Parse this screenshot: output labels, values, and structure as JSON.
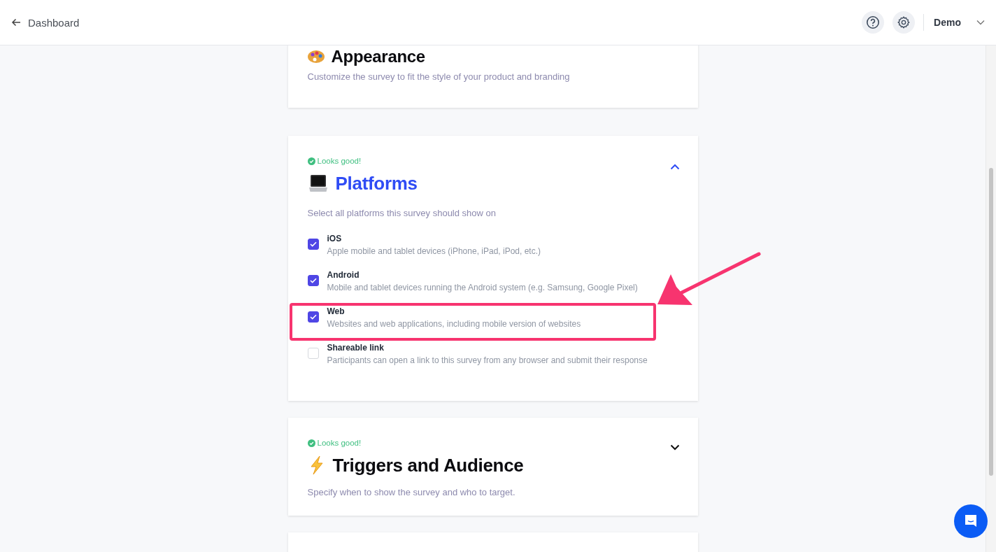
{
  "header": {
    "back_label": "Dashboard",
    "user": "Demo"
  },
  "sections": [
    {
      "title": "Appearance",
      "description": "Customize the survey to fit the style of your product and branding"
    },
    {
      "status": "Looks good!",
      "title": "Platforms",
      "expanded": true,
      "description": "Select all platforms this survey should show on",
      "options": [
        {
          "label": "iOS",
          "description": "Apple mobile and tablet devices (iPhone, iPad, iPod, etc.)",
          "checked": true
        },
        {
          "label": "Android",
          "description": "Mobile and tablet devices running the Android system (e.g. Samsung, Google Pixel)",
          "checked": true
        },
        {
          "label": "Web",
          "description": "Websites and web applications, including mobile version of websites",
          "checked": true
        },
        {
          "label": "Shareable link",
          "description": "Participants can open a link to this survey from any browser and submit their response",
          "checked": false
        }
      ]
    },
    {
      "status": "Looks good!",
      "title": "Triggers and Audience",
      "expanded": false,
      "description": "Specify when to show the survey and who to target."
    },
    {
      "kind": "empty"
    }
  ]
}
